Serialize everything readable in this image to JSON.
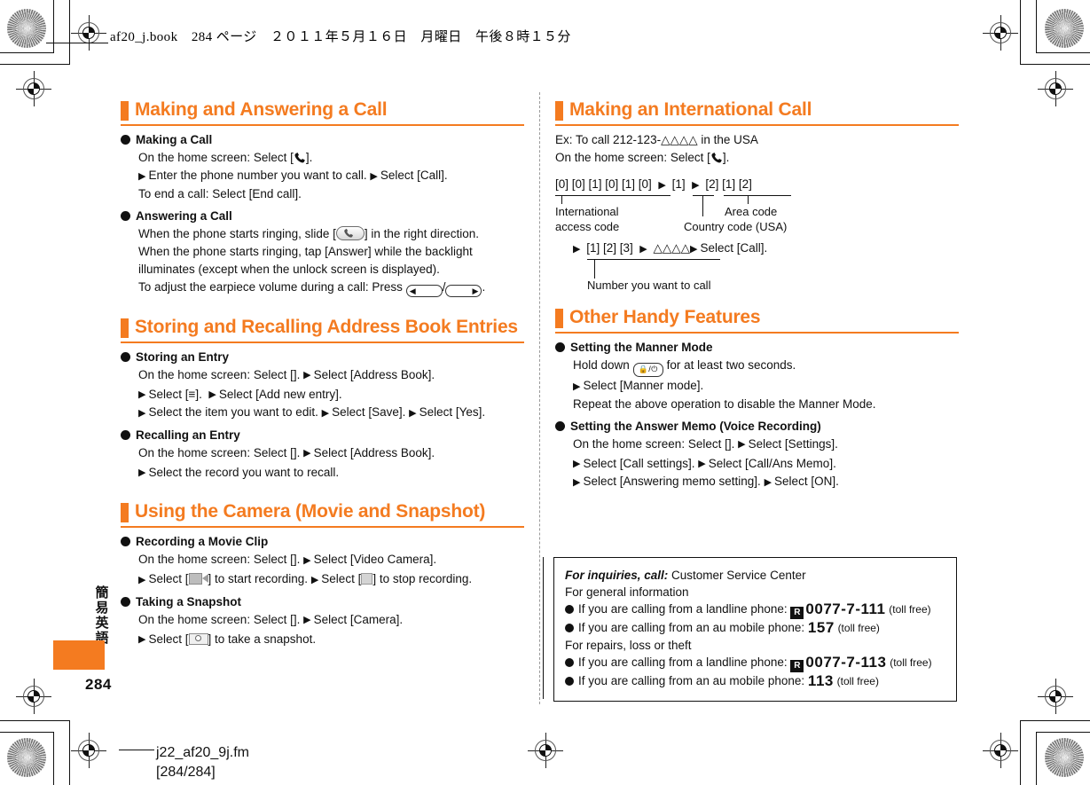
{
  "header": {
    "slug": "af20_j.book　284 ページ　２０１１年５月１６日　月曜日　午後８時１５分"
  },
  "side_tab": {
    "vertical_label": "簡易英語",
    "page_number": "284"
  },
  "footer": {
    "file_name": "j22_af20_9j.fm",
    "page_range": "[284/284]"
  },
  "colors": {
    "accent": "#f47b20",
    "text": "#111111"
  },
  "left_column": {
    "sections": [
      {
        "title": "Making and Answering a Call",
        "items": [
          {
            "heading": "Making a Call",
            "lines": [
              "On the home screen: Select [",
              "Enter the phone number you want to call.",
              "Select [Call].",
              "To end a call: Select [End call]."
            ]
          },
          {
            "heading": "Answering a Call",
            "lines": [
              "When the phone starts ringing, slide [",
              "] in the right direction.",
              "When the phone starts ringing, tap [Answer] while the backlight",
              "illuminates (except when the unlock screen is displayed).",
              "To adjust the earpiece volume during a call: Press"
            ]
          }
        ]
      },
      {
        "title": "Storing and Recalling Address Book Entries",
        "items": [
          {
            "heading": "Storing an Entry",
            "lines": [
              "On the home screen: Select [",
              "Select [Address Book].",
              "Select [≡].",
              "Select [Add new entry].",
              "Select the item you want to edit.",
              "Select [Save].",
              "Select [Yes]."
            ]
          },
          {
            "heading": "Recalling an Entry",
            "lines": [
              "On the home screen: Select [",
              "Select [Address Book].",
              "Select the record you want to recall."
            ]
          }
        ]
      },
      {
        "title": "Using the Camera (Movie and Snapshot)",
        "items": [
          {
            "heading": "Recording a Movie Clip",
            "lines": [
              "On the home screen: Select [",
              "Select [Video Camera].",
              "] to start recording.",
              "] to stop recording."
            ]
          },
          {
            "heading": "Taking a Snapshot",
            "lines": [
              "On the home screen: Select [",
              "Select [Camera].",
              "] to take a snapshot."
            ]
          }
        ]
      }
    ]
  },
  "right_column": {
    "sections": [
      {
        "title": "Making an International Call",
        "intro": [
          "Ex: To call 212-123-△△△△ in the USA",
          "On the home screen: Select ["
        ],
        "dial_diagram": {
          "row1_keys": "[0] [0] [1] [0] [1] [0]",
          "row1_country": "[1]",
          "row1_area": "[2] [1] [2]",
          "caption_access_1": "International",
          "caption_access_2": "access code",
          "caption_country": "Country code (USA)",
          "caption_area": "Area code",
          "row2_number": "[1] [2] [3]",
          "row2_triangles": "△△△△",
          "row2_select": "Select [Call].",
          "caption_number": "Number you want to call"
        }
      },
      {
        "title": "Other Handy Features",
        "items": [
          {
            "heading": "Setting the Manner Mode",
            "lines": [
              "Hold down",
              "for at least two seconds.",
              "Select [Manner mode].",
              "Repeat the above operation to disable the Manner Mode."
            ]
          },
          {
            "heading": "Setting the Answer Memo (Voice Recording)",
            "lines": [
              "On the home screen: Select [",
              "Select [Settings].",
              "Select [Call settings].",
              "Select [Call/Ans Memo].",
              "Select [Answering memo setting].",
              "Select [ON]."
            ]
          }
        ]
      }
    ]
  },
  "inquiry_box": {
    "lead": "For inquiries, call:",
    "lead_rest": " Customer Service Center",
    "general_label": "For general information",
    "general_landline_text": "If you are calling from a landline phone:",
    "general_landline_number": "0077-7-111",
    "general_landline_note": "(toll free)",
    "general_mobile_text": "If you are calling from an au mobile phone:",
    "general_mobile_number": "157",
    "general_mobile_note": "(toll free)",
    "repairs_label": "For repairs, loss or theft",
    "repairs_landline_text": "If you are calling from a landline phone:",
    "repairs_landline_number": "0077-7-113",
    "repairs_landline_note": "(toll free)",
    "repairs_mobile_text": "If you are calling from an au mobile phone:",
    "repairs_mobile_number": "113",
    "repairs_mobile_note": "(toll free)",
    "free_dial_mark": "free-dial-icon"
  },
  "icons": {
    "phone_handset": "phone-handset-icon",
    "app_drawer": "app-drawer-icon",
    "menu_lines": "menu-lines-icon",
    "slide_answer_key": "slide-answer-key-icon",
    "volume_down_key": "volume-down-key-icon",
    "volume_up_key": "volume-up-key-icon",
    "lock_power_key": "lock-power-key-icon",
    "video_camera": "video-camera-icon",
    "stop_record": "stop-record-icon",
    "camera_shutter": "camera-shutter-icon",
    "triangle_arrow": "triangle-arrow-icon"
  }
}
